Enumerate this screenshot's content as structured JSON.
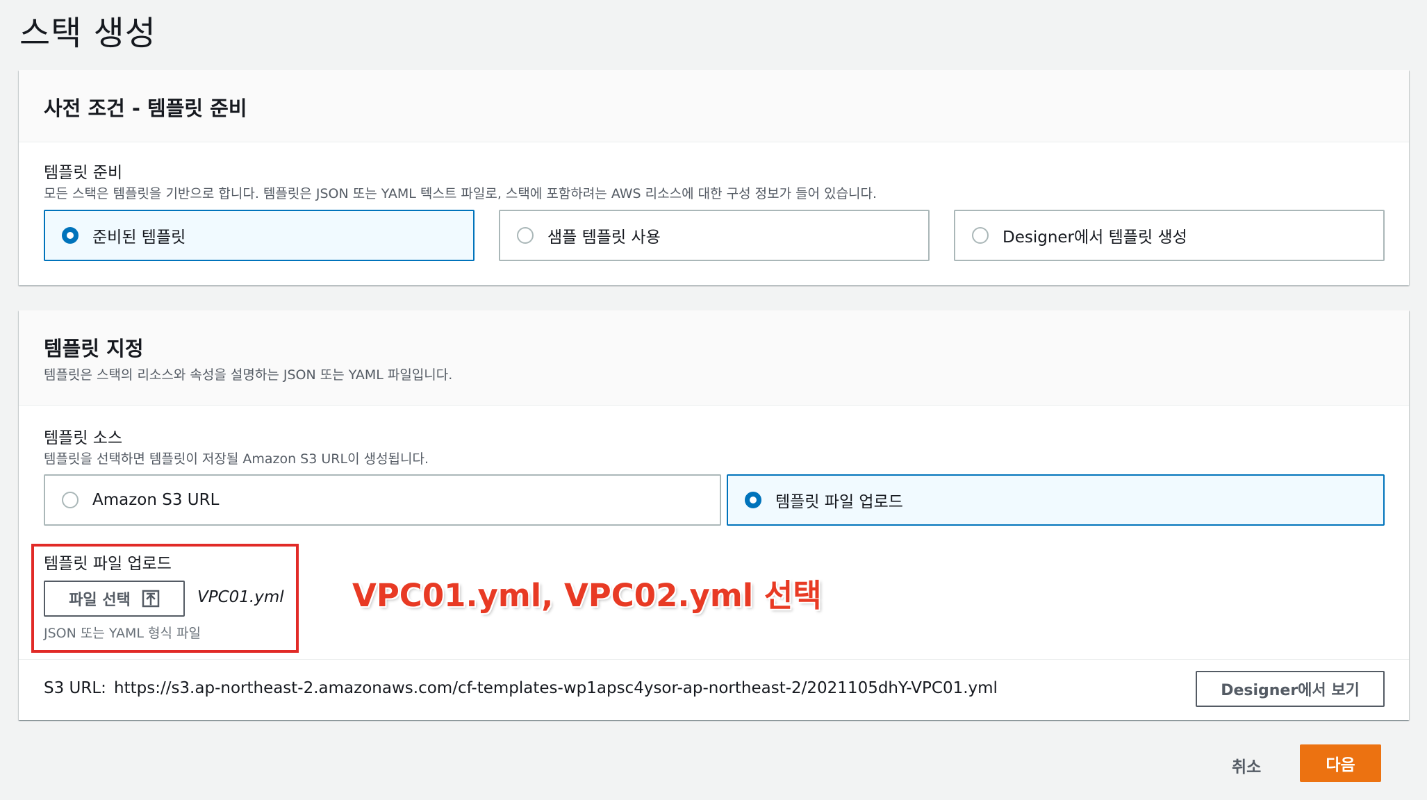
{
  "page": {
    "title": "스택 생성"
  },
  "prerequisite": {
    "heading": "사전 조건 - 템플릿 준비",
    "field_label": "템플릿 준비",
    "field_desc": "모든 스택은 템플릿을 기반으로 합니다. 템플릿은 JSON 또는 YAML 텍스트 파일로, 스택에 포함하려는 AWS 리소스에 대한 구성 정보가 들어 있습니다.",
    "options": [
      {
        "label": "준비된 템플릿",
        "selected": true
      },
      {
        "label": "샘플 템플릿 사용",
        "selected": false
      },
      {
        "label": "Designer에서 템플릿 생성",
        "selected": false
      }
    ]
  },
  "specify": {
    "heading": "템플릿 지정",
    "desc": "템플릿은 스택의 리소스와 속성을 설명하는 JSON 또는 YAML 파일입니다.",
    "source_label": "템플릿 소스",
    "source_desc": "템플릿을 선택하면 템플릿이 저장될 Amazon S3 URL이 생성됩니다.",
    "source_options": [
      {
        "label": "Amazon S3 URL",
        "selected": false
      },
      {
        "label": "템플릿 파일 업로드",
        "selected": true
      }
    ],
    "upload": {
      "label": "템플릿 파일 업로드",
      "button_label": "파일 선택",
      "file_name": "VPC01.yml",
      "hint": "JSON 또는 YAML 형식 파일"
    },
    "annotation": "VPC01.yml, VPC02.yml 선택",
    "s3_label": "S3 URL:",
    "s3_url": "https://s3.ap-northeast-2.amazonaws.com/cf-templates-wp1apsc4ysor-ap-northeast-2/2021105dhY-VPC01.yml",
    "designer_button": "Designer에서 보기"
  },
  "footer": {
    "cancel_label": "취소",
    "next_label": "다음"
  },
  "colors": {
    "primary_blue": "#0073bb",
    "orange": "#ec7211",
    "annotation_red": "#e12a27"
  }
}
